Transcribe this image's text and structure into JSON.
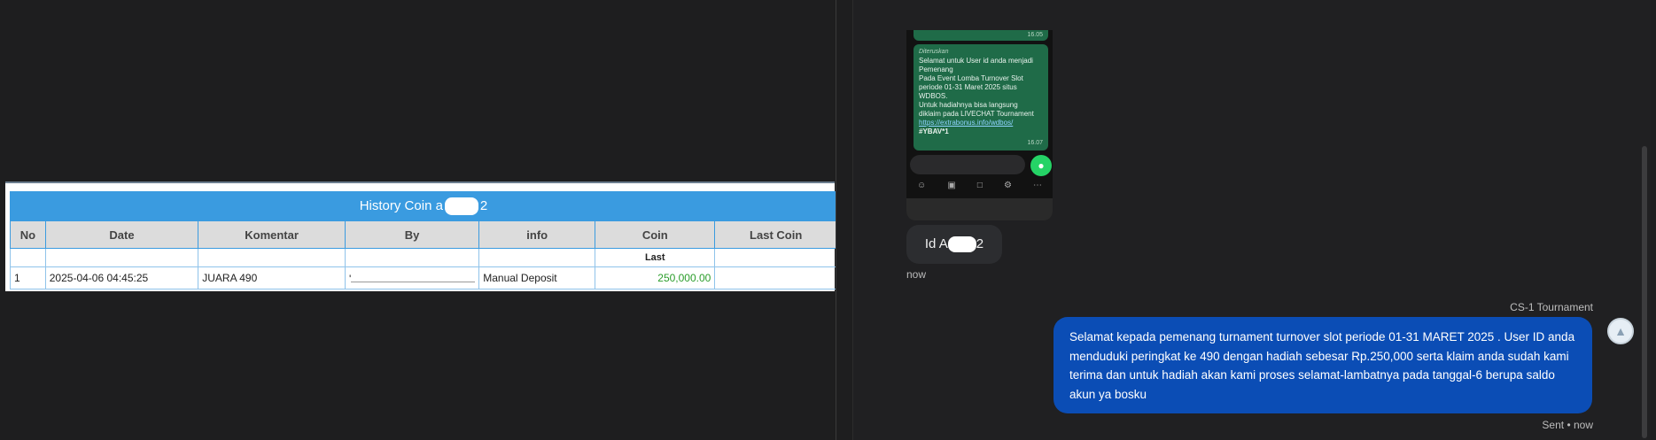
{
  "history": {
    "title_prefix": "History Coin a",
    "title_suffix": "2",
    "columns": [
      "No",
      "Date",
      "Komentar",
      "By",
      "info",
      "Coin",
      "Last Coin"
    ],
    "sub_label": "Last",
    "rows": [
      {
        "no": "1",
        "date": "2025-04-06 04:45:25",
        "komentar": "JUARA 490",
        "by": "'",
        "info": "Manual Deposit",
        "coin": "250,000.00",
        "last_coin": ""
      }
    ]
  },
  "phone": {
    "top_time": "16.05",
    "forwarded_label": "Diteruskan",
    "message_lines": [
      "Selamat untuk User id anda menjadi",
      "Pemenang",
      "Pada Event Lomba Turnover Slot",
      "periode 01-31 Maret 2025 situs WDBOS.",
      "Untuk hadiahnya bisa langsung",
      "diklaim pada LIVECHAT Tournament"
    ],
    "link": "https://extrabonus.info/wdbos/",
    "tag": "#YBAV*1",
    "time": "16.07"
  },
  "chat": {
    "user_message_prefix": "Id A",
    "user_message_suffix": "2",
    "user_time": "now",
    "agent_name": "CS-1 Tournament",
    "agent_message": "Selamat kepada pemenang turnament turnover slot periode 01-31 MARET 2025 . User ID anda menduduki peringkat ke 490 dengan hadiah sebesar Rp.250,000 serta klaim anda sudah kami terima dan untuk hadiah akan kami proses selamat-lambatnya pada tanggal-6 berupa saldo akun ya bosku",
    "sent_status": "Sent • now"
  },
  "colors": {
    "table_header": "#3a9be0",
    "agent_bubble": "#0b4db5",
    "coin_text": "#2a9d2a",
    "wa_bubble": "#1f6b48"
  }
}
